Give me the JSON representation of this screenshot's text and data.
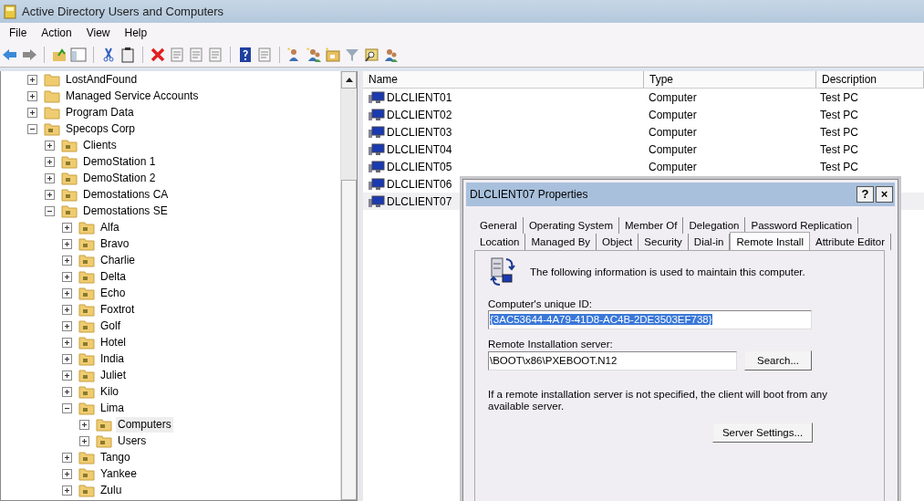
{
  "window": {
    "title": "Active Directory Users and Computers"
  },
  "menu": [
    "File",
    "Action",
    "View",
    "Help"
  ],
  "tree": [
    {
      "label": "LostAndFound",
      "kind": "plain",
      "expanded": false,
      "selected": false
    },
    {
      "label": "Managed Service Accounts",
      "kind": "plain",
      "expanded": false,
      "selected": false
    },
    {
      "label": "Program Data",
      "kind": "plain",
      "expanded": false,
      "selected": false
    },
    {
      "label": "Specops Corp",
      "kind": "ou",
      "expanded": true,
      "selected": false,
      "children": [
        {
          "label": "Clients",
          "kind": "ou",
          "expanded": false,
          "selected": false
        },
        {
          "label": "DemoStation 1",
          "kind": "ou",
          "expanded": false,
          "selected": false
        },
        {
          "label": "DemoStation 2",
          "kind": "ou",
          "expanded": false,
          "selected": false
        },
        {
          "label": "Demostations CA",
          "kind": "ou",
          "expanded": false,
          "selected": false
        },
        {
          "label": "Demostations SE",
          "kind": "ou",
          "expanded": true,
          "selected": false,
          "children": [
            {
              "label": "Alfa",
              "kind": "ou",
              "expanded": false,
              "selected": false
            },
            {
              "label": "Bravo",
              "kind": "ou",
              "expanded": false,
              "selected": false
            },
            {
              "label": "Charlie",
              "kind": "ou",
              "expanded": false,
              "selected": false
            },
            {
              "label": "Delta",
              "kind": "ou",
              "expanded": false,
              "selected": false
            },
            {
              "label": "Echo",
              "kind": "ou",
              "expanded": false,
              "selected": false
            },
            {
              "label": "Foxtrot",
              "kind": "ou",
              "expanded": false,
              "selected": false
            },
            {
              "label": "Golf",
              "kind": "ou",
              "expanded": false,
              "selected": false
            },
            {
              "label": "Hotel",
              "kind": "ou",
              "expanded": false,
              "selected": false
            },
            {
              "label": "India",
              "kind": "ou",
              "expanded": false,
              "selected": false
            },
            {
              "label": "Juliet",
              "kind": "ou",
              "expanded": false,
              "selected": false
            },
            {
              "label": "Kilo",
              "kind": "ou",
              "expanded": false,
              "selected": false
            },
            {
              "label": "Lima",
              "kind": "ou",
              "expanded": true,
              "selected": false,
              "children": [
                {
                  "label": "Computers",
                  "kind": "ou",
                  "expanded": false,
                  "selected": true
                },
                {
                  "label": "Users",
                  "kind": "ou",
                  "expanded": false,
                  "selected": false
                }
              ]
            },
            {
              "label": "Tango",
              "kind": "ou",
              "expanded": false,
              "selected": false
            },
            {
              "label": "Yankee",
              "kind": "ou",
              "expanded": false,
              "selected": false
            },
            {
              "label": "Zulu",
              "kind": "ou",
              "expanded": false,
              "selected": false
            }
          ]
        }
      ]
    }
  ],
  "list": {
    "columns": [
      "Name",
      "Type",
      "Description"
    ],
    "rows": [
      {
        "name": "DLCLIENT01",
        "type": "Computer",
        "description": "Test PC",
        "selected": false
      },
      {
        "name": "DLCLIENT02",
        "type": "Computer",
        "description": "Test PC",
        "selected": false
      },
      {
        "name": "DLCLIENT03",
        "type": "Computer",
        "description": "Test PC",
        "selected": false
      },
      {
        "name": "DLCLIENT04",
        "type": "Computer",
        "description": "Test PC",
        "selected": false
      },
      {
        "name": "DLCLIENT05",
        "type": "Computer",
        "description": "Test PC",
        "selected": false
      },
      {
        "name": "DLCLIENT06",
        "selected": false
      },
      {
        "name": "DLCLIENT07",
        "selected": true
      }
    ]
  },
  "dialog": {
    "title": "DLCLIENT07 Properties",
    "help": "?",
    "close": "×",
    "tab_rows": [
      [
        {
          "label": "General",
          "selected": false
        },
        {
          "label": "Operating System",
          "selected": false
        },
        {
          "label": "Member Of",
          "selected": false
        },
        {
          "label": "Delegation",
          "selected": false
        },
        {
          "label": "Password Replication",
          "selected": false
        }
      ],
      [
        {
          "label": "Location",
          "selected": false
        },
        {
          "label": "Managed By",
          "selected": false
        },
        {
          "label": "Object",
          "selected": false
        },
        {
          "label": "Security",
          "selected": false
        },
        {
          "label": "Dial-in",
          "selected": false
        },
        {
          "label": "Remote Install",
          "selected": true
        },
        {
          "label": "Attribute Editor",
          "selected": false
        }
      ]
    ],
    "intro": "The following information is used to maintain this computer.",
    "unique_id": {
      "label": "Computer's unique ID:",
      "value": "{3AC53644-4A79-41D8-AC4B-2DE3503EF738}",
      "highlighted": true
    },
    "server": {
      "label": "Remote Installation server:",
      "value": "\\BOOT\\x86\\PXEBOOT.N12",
      "button": "Search..."
    },
    "note": "If a remote installation server is not specified, the client will boot from any available server.",
    "settings_button": "Server Settings..."
  }
}
